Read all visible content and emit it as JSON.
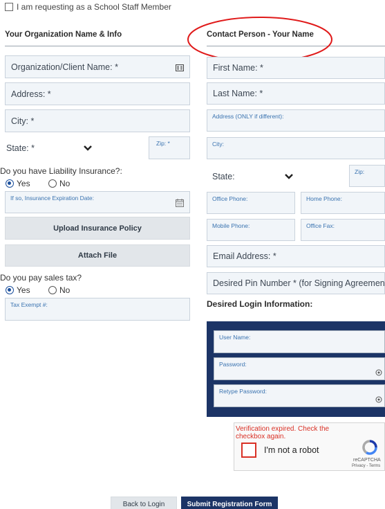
{
  "top": {
    "staff_checkbox_label": "I am requesting as a School Staff Member"
  },
  "org": {
    "title": "Your Organization Name & Info",
    "name_placeholder": "Organization/Client Name: *",
    "address_placeholder": "Address: *",
    "city_placeholder": "City: *",
    "state_placeholder": "State: *",
    "zip_label": "Zip: *",
    "liability_question": "Do you have Liability Insurance?:",
    "liability_yes": "Yes",
    "liability_no": "No",
    "insurance_exp_label": "If so, Insurance Expiration Date:",
    "upload_button": "Upload Insurance Policy",
    "attach_button": "Attach File",
    "sales_tax_question": "Do you pay sales tax?",
    "sales_tax_yes": "Yes",
    "sales_tax_no": "No",
    "tax_exempt_label": "Tax Exempt #:"
  },
  "contact": {
    "title": "Contact Person - Your Name",
    "first_name": "First Name: *",
    "last_name": "Last Name: *",
    "address_label": "Address (ONLY if different):",
    "city_label": "City:",
    "state_placeholder": "State:",
    "zip_label": "Zip:",
    "office_phone": "Office Phone:",
    "home_phone": "Home Phone:",
    "mobile_phone": "Mobile Phone:",
    "office_fax": "Office Fax:",
    "email": "Email Address: *",
    "pin": "Desired Pin Number * (for Signing Agreements)",
    "login_title": "Desired Login Information:",
    "username_label": "User Name:",
    "password_label": "Password:",
    "retype_password_label": "Retype Password:"
  },
  "captcha": {
    "expired_msg": "Verification expired. Check the checkbox again.",
    "checkbox_label": "I'm not a robot",
    "brand": "reCAPTCHA",
    "links": "Privacy - Terms"
  },
  "footer": {
    "back_button": "Back to Login",
    "submit_button": "Submit Registration Form"
  },
  "colors": {
    "navy": "#1c3466",
    "annotation_red": "#e01a1a",
    "link_blue": "#3a73b0"
  }
}
